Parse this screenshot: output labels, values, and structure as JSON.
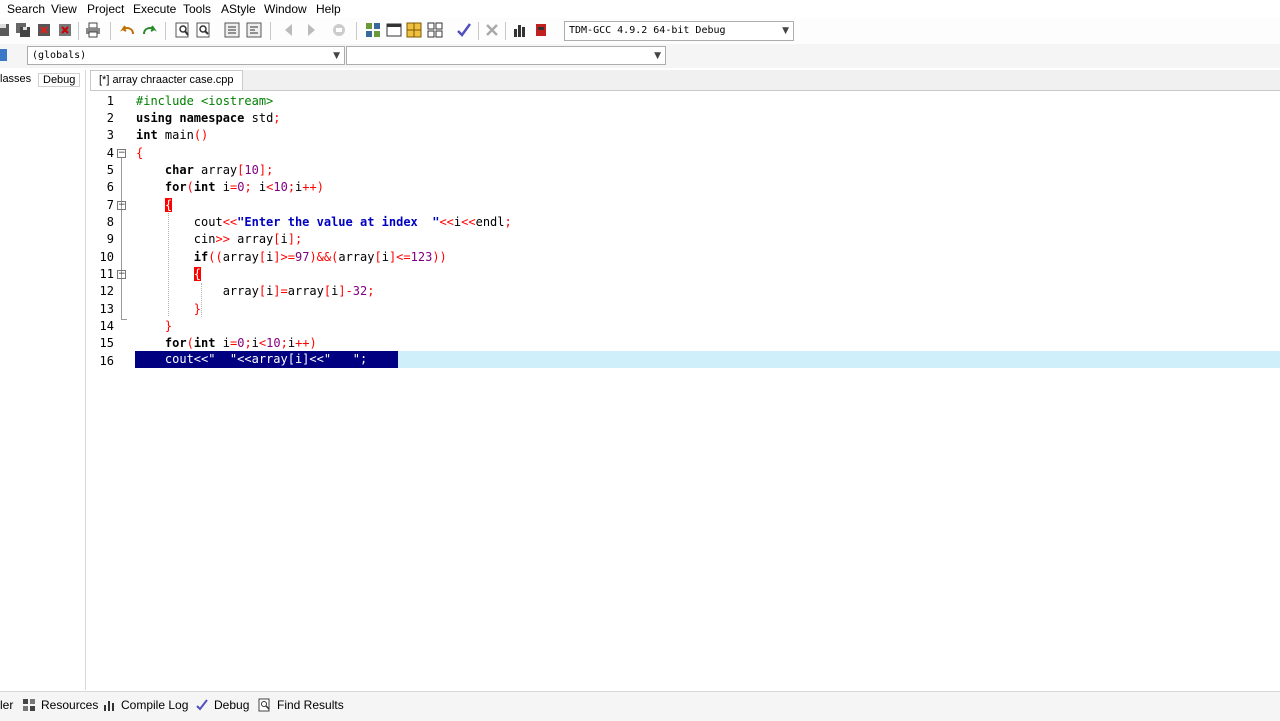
{
  "menu": [
    "Search",
    "View",
    "Project",
    "Execute",
    "Tools",
    "AStyle",
    "Window",
    "Help"
  ],
  "compiler_select": "TDM-GCC 4.9.2 64-bit Debug",
  "scope_select": "(globals)",
  "member_select": "",
  "left_tabs": [
    "lasses",
    "Debug"
  ],
  "file_tab": "[*] array chraacter case.cpp",
  "code_lines": [
    {
      "n": "1",
      "text": "#include <iostream>"
    },
    {
      "n": "2",
      "text": "using namespace std;"
    },
    {
      "n": "3",
      "text": "int main()"
    },
    {
      "n": "4",
      "text": "{"
    },
    {
      "n": "5",
      "text": "    char array[10];"
    },
    {
      "n": "6",
      "text": "    for(int i=0; i<10;i++)"
    },
    {
      "n": "7",
      "text": "    {"
    },
    {
      "n": "8",
      "text": "        cout<<\"Enter the value at index  \"<<i<<endl;"
    },
    {
      "n": "9",
      "text": "        cin>> array[i];"
    },
    {
      "n": "10",
      "text": "        if((array[i]>=97)&&(array[i]<=123))"
    },
    {
      "n": "11",
      "text": "        {"
    },
    {
      "n": "12",
      "text": "            array[i]=array[i]-32;"
    },
    {
      "n": "13",
      "text": "        }"
    },
    {
      "n": "14",
      "text": "    }"
    },
    {
      "n": "15",
      "text": "    for(int i=0;i<10;i++)"
    },
    {
      "n": "16",
      "text": "    cout<<\"  \"<<array[i]<<\"   \";"
    }
  ],
  "bottom_tabs": [
    "ler",
    "Resources",
    "Compile Log",
    "Debug",
    "Find Results"
  ],
  "colors": {
    "selection": "#000080",
    "current_line": "#cfeffb",
    "keyword": "#000000",
    "string": "#0000c0",
    "operator": "#ff0000",
    "number": "#800080",
    "preprocessor": "#008000"
  }
}
